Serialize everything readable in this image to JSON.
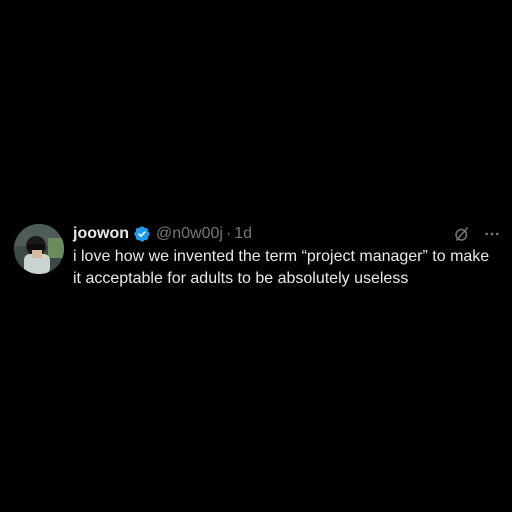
{
  "tweet": {
    "display_name": "joowon",
    "handle": "@n0w00j",
    "separator": "·",
    "timestamp": "1d",
    "text": "i love how we invented the term “project manager” to make it acceptable for adults to be absolutely useless",
    "icons": {
      "verified": "verified-badge-icon",
      "grok": "grok-icon",
      "more": "more-options-icon"
    }
  },
  "colors": {
    "background": "#000000",
    "primary_text": "#e7e9ea",
    "secondary_text": "#71767b",
    "verified_blue": "#1d9bf0"
  }
}
